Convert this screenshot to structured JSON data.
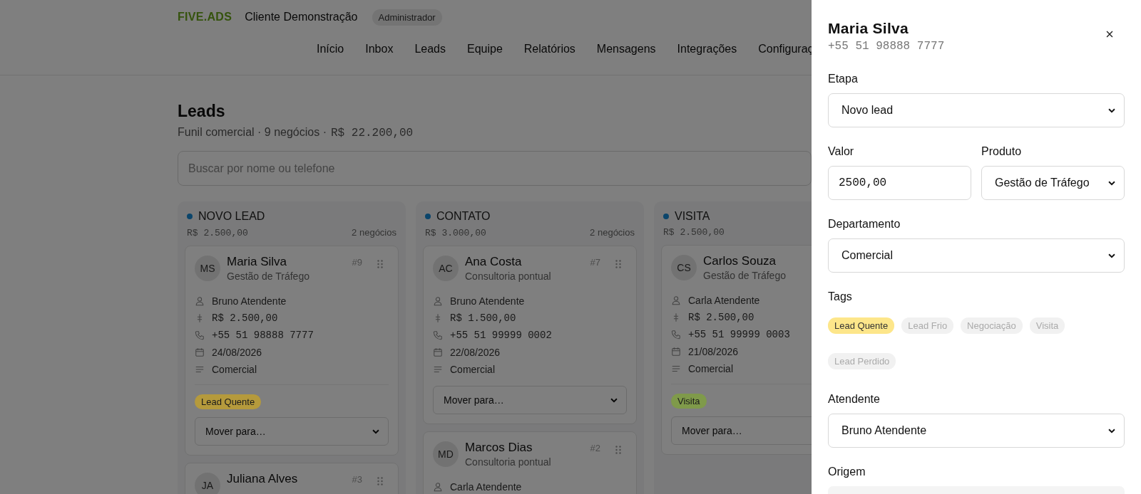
{
  "header": {
    "logo": "FIVE.ADS",
    "client": "Cliente Demonstração",
    "role_badge": "Administrador",
    "nav": [
      {
        "label": "Início",
        "selected": false
      },
      {
        "label": "Inbox",
        "selected": false
      },
      {
        "label": "Leads",
        "selected": false
      },
      {
        "label": "Equipe",
        "selected": false
      },
      {
        "label": "Relatórios",
        "selected": false
      },
      {
        "label": "Mensagens",
        "selected": false
      },
      {
        "label": "Integrações",
        "selected": false
      },
      {
        "label": "Configuraç",
        "selected": false
      }
    ]
  },
  "page": {
    "title": "Leads",
    "subtitle": "Funil comercial · 9 negócios ·",
    "total": "R$ 22.200,00",
    "search": {
      "placeholder": "Buscar por nome ou telefone"
    }
  },
  "columns": [
    {
      "title": "NOVO LEAD",
      "total": "R$ 2.500,00",
      "count": "2 negócios",
      "cards": [
        {
          "initials": "MS",
          "name": "Maria Silva",
          "product": "Gestão de Tráfego",
          "number": "#9",
          "attendant": "Bruno Atendente",
          "value": "R$ 2.500,00",
          "phone": "+55 51 98888 7777",
          "date": "24/08/2026",
          "department": "Comercial",
          "tags": [
            {
              "label": "Lead Quente",
              "color": "#b59a3c"
            }
          ],
          "move": "Mover para…"
        },
        {
          "initials": "JA",
          "name": "Juliana Alves",
          "number": "#3"
        }
      ]
    },
    {
      "title": "CONTATO",
      "total": "R$ 3.000,00",
      "count": "2 negócios",
      "cards": [
        {
          "initials": "AC",
          "name": "Ana Costa",
          "product": "Consultoria pontual",
          "number": "#7",
          "attendant": "Bruno Atendente",
          "value": "R$ 1.500,00",
          "phone": "+55 51 99999 0002",
          "date": "22/08/2026",
          "department": "Comercial",
          "move": "Mover para…"
        },
        {
          "initials": "MD",
          "name": "Marcos Dias",
          "product": "Consultoria pontual",
          "number": "#2",
          "attendant": "Carla Atendente"
        }
      ]
    },
    {
      "title": "VISITA",
      "total": "R$ 2.500,00",
      "cards": [
        {
          "initials": "CS",
          "name": "Carlos Souza",
          "product": "Gestão de Tráfego",
          "attendant": "Carla Atendente",
          "value": "R$ 2.500,00",
          "phone": "+55 51 99999 0003",
          "date": "21/08/2026",
          "department": "Comercial",
          "tags": [
            {
              "label": "Visita",
              "color": "#7f9a4a"
            }
          ],
          "move": "Mover para…"
        }
      ]
    }
  ],
  "drawer": {
    "title": "Maria Silva",
    "phone": "+55 51 98888 7777",
    "fields": [
      {
        "kind": "select",
        "label": "Etapa",
        "value": "Novo lead"
      },
      {
        "kind": "pair",
        "fields": [
          {
            "kind": "input",
            "label": "Valor",
            "value": "2500,00"
          },
          {
            "kind": "select",
            "label": "Produto",
            "value": "Gestão de Tráfego"
          }
        ]
      },
      {
        "kind": "select",
        "label": "Departamento",
        "value": "Comercial"
      },
      {
        "kind": "tags",
        "label": "Tags",
        "tags": [
          {
            "label": "Lead Quente",
            "selected": true,
            "color": "#fde68a"
          },
          {
            "label": "Lead Frio",
            "selected": false
          },
          {
            "label": "Negociação",
            "selected": false
          },
          {
            "label": "Visita",
            "selected": false
          },
          {
            "label": "Lead Perdido",
            "selected": false
          }
        ]
      },
      {
        "kind": "select",
        "label": "Atendente",
        "value": "Bruno Atendente"
      },
      {
        "kind": "empty",
        "label": "Origem"
      }
    ]
  }
}
